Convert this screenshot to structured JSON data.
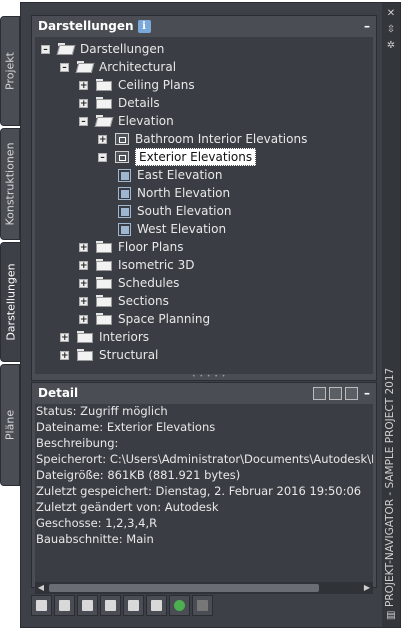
{
  "left_tabs": [
    "Projekt",
    "Konstruktionen",
    "Darstellungen",
    "Pläne"
  ],
  "right_strip": {
    "title": "PROJEKT-NAVIGATOR - SAMPLE PROJECT 2017"
  },
  "views_panel": {
    "title": "Darstellungen",
    "info_icon": "i",
    "minimize": "–",
    "tree": [
      {
        "label": "Darstellungen",
        "exp": "–",
        "icon": "folder-open"
      },
      {
        "label": "Architectural",
        "exp": "–",
        "icon": "folder-open"
      },
      {
        "label": "Ceiling Plans",
        "exp": "+",
        "icon": "folder"
      },
      {
        "label": "Details",
        "exp": "+",
        "icon": "folder"
      },
      {
        "label": "Elevation",
        "exp": "–",
        "icon": "folder-open"
      },
      {
        "label": "Bathroom Interior Elevations",
        "exp": "+",
        "icon": "view"
      },
      {
        "label": "Exterior Elevations",
        "exp": "–",
        "icon": "view"
      },
      {
        "label": "East Elevation",
        "exp": "",
        "icon": "elevation"
      },
      {
        "label": "North Elevation",
        "exp": "",
        "icon": "elevation"
      },
      {
        "label": "South Elevation",
        "exp": "",
        "icon": "elevation"
      },
      {
        "label": "West Elevation",
        "exp": "",
        "icon": "elevation"
      },
      {
        "label": "Floor Plans",
        "exp": "+",
        "icon": "folder"
      },
      {
        "label": "Isometric 3D",
        "exp": "+",
        "icon": "folder"
      },
      {
        "label": "Schedules",
        "exp": "+",
        "icon": "folder"
      },
      {
        "label": "Sections",
        "exp": "+",
        "icon": "folder"
      },
      {
        "label": "Space Planning",
        "exp": "+",
        "icon": "folder"
      },
      {
        "label": "Interiors",
        "exp": "+",
        "icon": "folder"
      },
      {
        "label": "Structural",
        "exp": "+",
        "icon": "folder"
      }
    ]
  },
  "detail_panel": {
    "title": "Detail",
    "minimize": "–",
    "lines": [
      "Status: Zugriff möglich",
      "Dateiname: Exterior Elevations",
      "Beschreibung:",
      "Speicherort: C:\\Users\\Administrator\\Documents\\Autodesk\\Eige",
      "Dateigröße: 861KB (881.921 bytes)",
      "Zuletzt gespeichert: Dienstag, 2. Februar 2016  19:50:06",
      "Zuletzt geändert von: Autodesk",
      "Geschosse: 1,2,3,4,R",
      "Bauabschnitte: Main"
    ]
  },
  "toolbar": [
    "new-view-icon",
    "add-view-icon",
    "regenerate-icon",
    "clipboard-icon",
    "select-icon",
    "properties-icon",
    "refresh-icon",
    "delete-icon"
  ]
}
